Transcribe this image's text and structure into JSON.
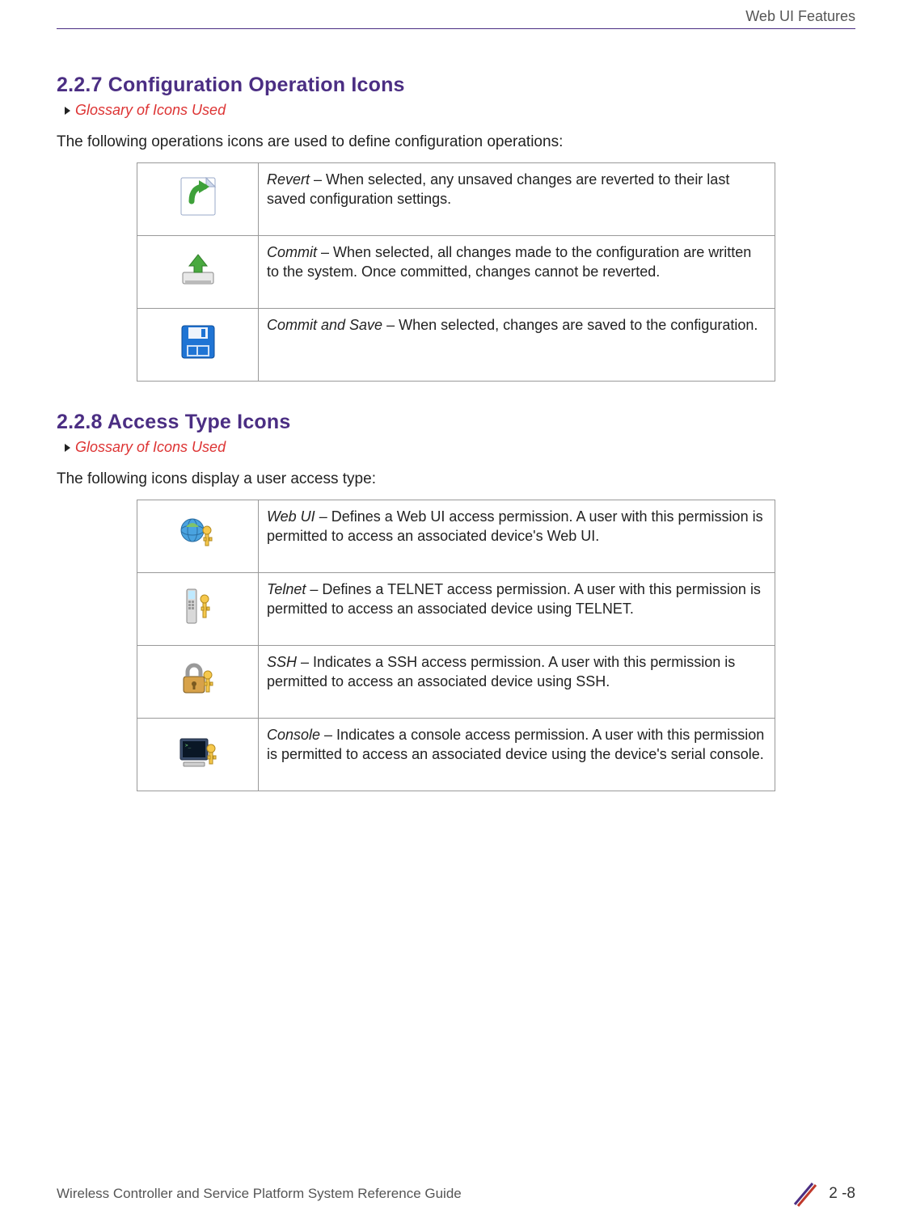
{
  "header": {
    "running_title": "Web UI Features"
  },
  "sections": [
    {
      "heading": "2.2.7 Configuration Operation Icons",
      "breadcrumb": "Glossary of Icons Used",
      "intro": "The following operations icons are used to define configuration operations:",
      "rows": [
        {
          "term": "Revert",
          "desc": " – When selected, any unsaved changes are reverted to their last saved configuration settings."
        },
        {
          "term": "Commit",
          "desc": " – When selected, all changes made to the configuration are written to the system. Once committed, changes cannot be reverted."
        },
        {
          "term": "Commit and Save",
          "desc": " – When selected, changes are saved to the configuration."
        }
      ]
    },
    {
      "heading": "2.2.8 Access Type Icons",
      "breadcrumb": "Glossary of Icons Used",
      "intro": "The following icons display a user access type:",
      "rows": [
        {
          "term": "Web UI",
          "desc": " – Defines a Web UI access permission. A user with this permission is permitted to access an associated device's Web UI."
        },
        {
          "term": "Telnet",
          "desc": " – Defines a TELNET access permission. A user with this permission is permitted to access an associated device using TELNET."
        },
        {
          "term": "SSH",
          "desc": " – Indicates a SSH access permission. A user with this permission is permitted to access an associated device using SSH."
        },
        {
          "term": "Console",
          "desc": " – Indicates a console access permission. A user with this permission is permitted to access an associated device using the device's serial console."
        }
      ]
    }
  ],
  "footer": {
    "doc_title": "Wireless Controller and Service Platform System Reference Guide",
    "page_number": "2 -8"
  }
}
